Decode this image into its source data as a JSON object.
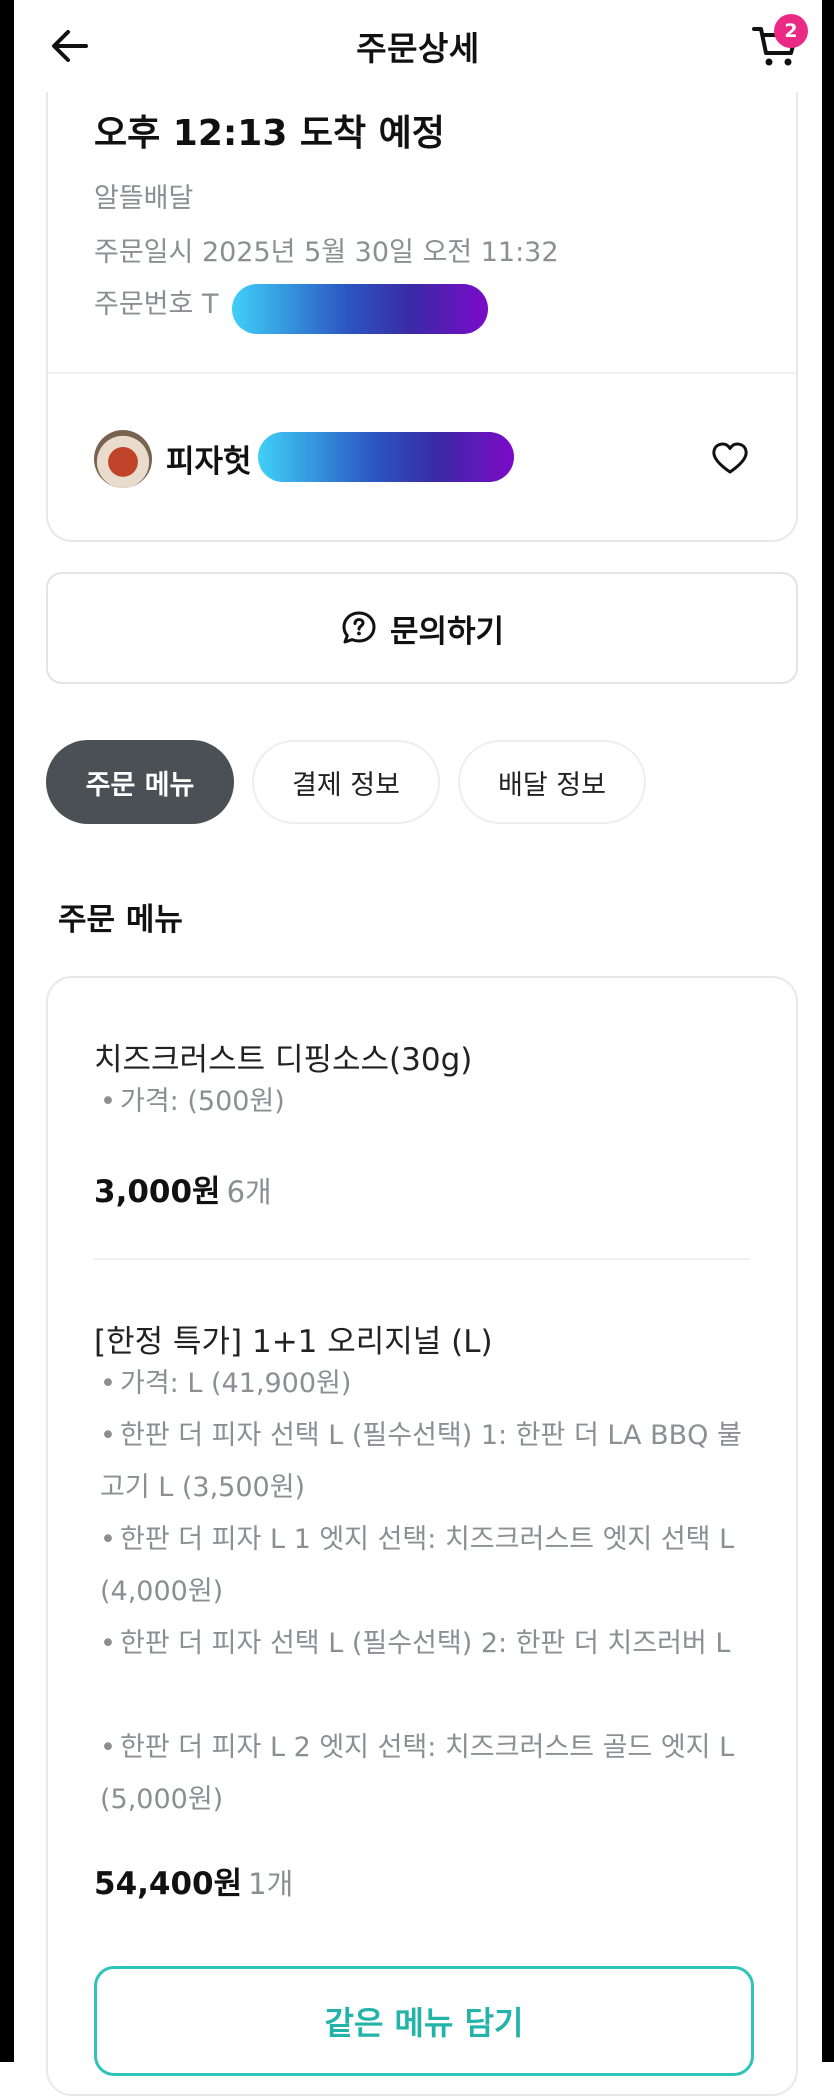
{
  "header": {
    "title": "주문상세",
    "cart_count": "2"
  },
  "order": {
    "eta": "오후 12:13 도착 예정",
    "delivery_type": "알뜰배달",
    "ordered_at": "주문일시 2025년 5월 30일 오전 11:32",
    "order_number": "주문번호 T"
  },
  "store": {
    "name": "피자헛"
  },
  "inquiry": {
    "label": "문의하기"
  },
  "tabs": [
    {
      "label": "주문 메뉴",
      "active": true
    },
    {
      "label": "결제 정보",
      "active": false
    },
    {
      "label": "배달 정보",
      "active": false
    }
  ],
  "section": {
    "title": "주문 메뉴"
  },
  "menu_items": [
    {
      "name": "치즈크러스트 디핑소스(30g)",
      "options": [
        "가격: (500원)"
      ],
      "price": "3,000원",
      "qty": "6개"
    },
    {
      "name": "[한정 특가] 1+1 오리지널 (L)",
      "options": [
        "가격: L (41,900원)",
        "한판 더 피자 선택 L (필수선택) 1: 한판 더 LA BBQ 불고기 L (3,500원)",
        "한판 더 피자 L 1 엣지 선택: 치즈크러스트 엣지 선택 L (4,000원)",
        "한판 더 피자 선택 L (필수선택) 2: 한판 더 치즈러버 L",
        "한판 더 피자 L 2 엣지 선택: 치즈크러스트 골드 엣지 L (5,000원)"
      ],
      "price": "54,400원",
      "qty": "1개"
    }
  ],
  "reorder": {
    "label": "같은 메뉴 담기"
  },
  "colors": {
    "accent": "#2ec5b9",
    "badge": "#ea2a85",
    "tab_active": "#4b5055"
  }
}
